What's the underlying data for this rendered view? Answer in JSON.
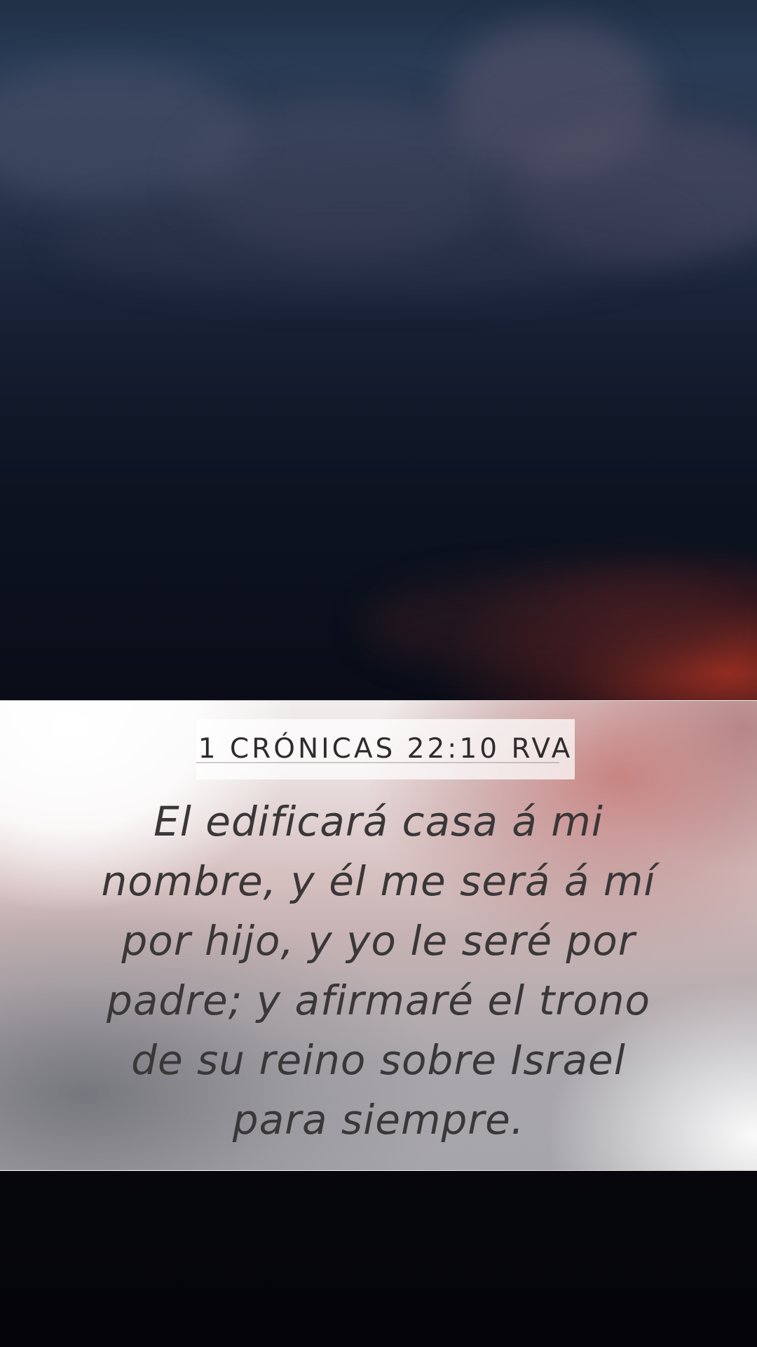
{
  "reference": "1 Crónicas 22:10 RVA",
  "verse": "El edificará casa á mi nombre, y él me será á mí por hijo, y yo le seré por padre; y afirmaré el trono de su reino sobre Israel para siempre.",
  "colors": {
    "sky_top": "#1f3047",
    "sky_bottom": "#040409",
    "glow": "#aa3223",
    "text": "#3a3738"
  }
}
